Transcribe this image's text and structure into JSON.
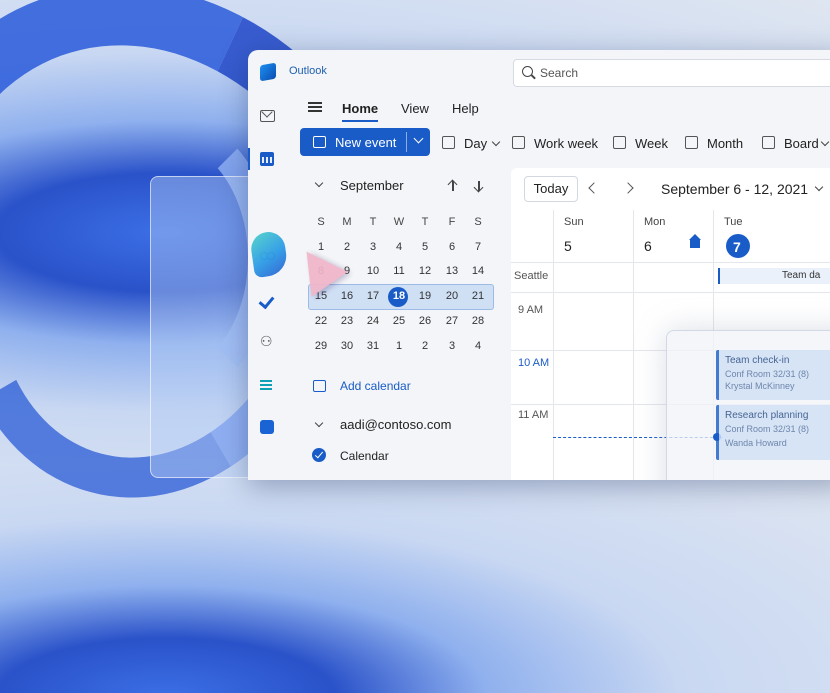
{
  "app": {
    "name": "Outlook"
  },
  "search": {
    "placeholder": "Search"
  },
  "ribbon": {
    "tabs": [
      "Home",
      "View",
      "Help"
    ]
  },
  "toolbar": {
    "new_event": "New event",
    "views": [
      "Day",
      "Work week",
      "Week",
      "Month",
      "Board"
    ]
  },
  "minical": {
    "month": "September",
    "dow": [
      "S",
      "M",
      "T",
      "W",
      "T",
      "F",
      "S"
    ],
    "weeks": [
      [
        "",
        "1",
        "2",
        "3",
        "4",
        "5",
        "6",
        "7"
      ],
      [
        "",
        "8",
        "9",
        "10",
        "11",
        "12",
        "13",
        "14"
      ],
      [
        "",
        "15",
        "16",
        "17",
        "18",
        "19",
        "20",
        "21"
      ],
      [
        "",
        "22",
        "23",
        "24",
        "25",
        "26",
        "27",
        "28"
      ],
      [
        "",
        "29",
        "30",
        "31",
        "1",
        "2",
        "3",
        "4"
      ]
    ],
    "today": "18"
  },
  "sidebar": {
    "add_calendar": "Add calendar",
    "account": "aadi@contoso.com",
    "calendar_name": "Calendar"
  },
  "grid": {
    "today_button": "Today",
    "range": "September 6 - 12, 2021",
    "days": [
      {
        "name": "Sun",
        "num": "5"
      },
      {
        "name": "Mon",
        "num": "6"
      },
      {
        "name": "Tue",
        "num": "7"
      }
    ],
    "timezone": "Seattle",
    "times": [
      "9 AM",
      "10 AM",
      "11 AM"
    ],
    "events": [
      {
        "title": "Team check-in",
        "sub1": "Conf Room 32/31 (8)",
        "sub2": "Krystal McKinney"
      },
      {
        "title": "Research planning",
        "sub1": "Conf Room 32/31 (8)",
        "sub2": "Wanda Howard"
      }
    ],
    "allday": "Team da"
  },
  "colors": {
    "accent": "#1a5cc7",
    "week_highlight": "#cfe0f5"
  }
}
